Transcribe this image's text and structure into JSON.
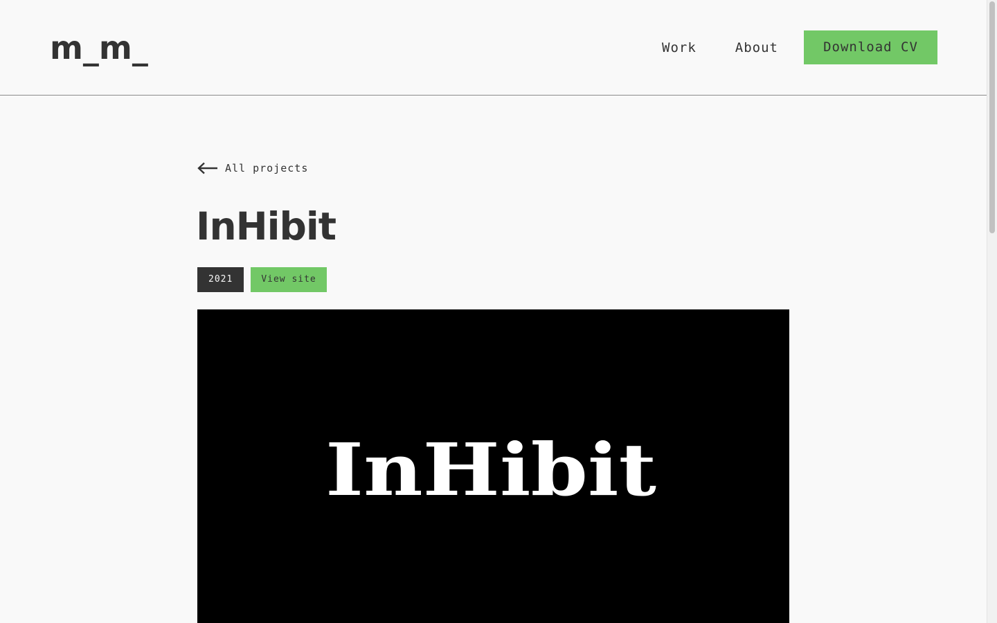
{
  "header": {
    "logo_text": "m_m_",
    "nav": {
      "work_label": "Work",
      "about_label": "About",
      "cv_button_label": "Download CV"
    }
  },
  "project": {
    "back_label": "All projects",
    "title": "InHibit",
    "year": "2021",
    "view_site_label": "View site",
    "hero_logo_text": "InHibit"
  },
  "colors": {
    "accent_green": "#72c866",
    "text_dark": "#333333",
    "background": "#f9f9f9",
    "hero_background": "#000000"
  },
  "icons": {
    "back": "arrow-left-icon"
  }
}
